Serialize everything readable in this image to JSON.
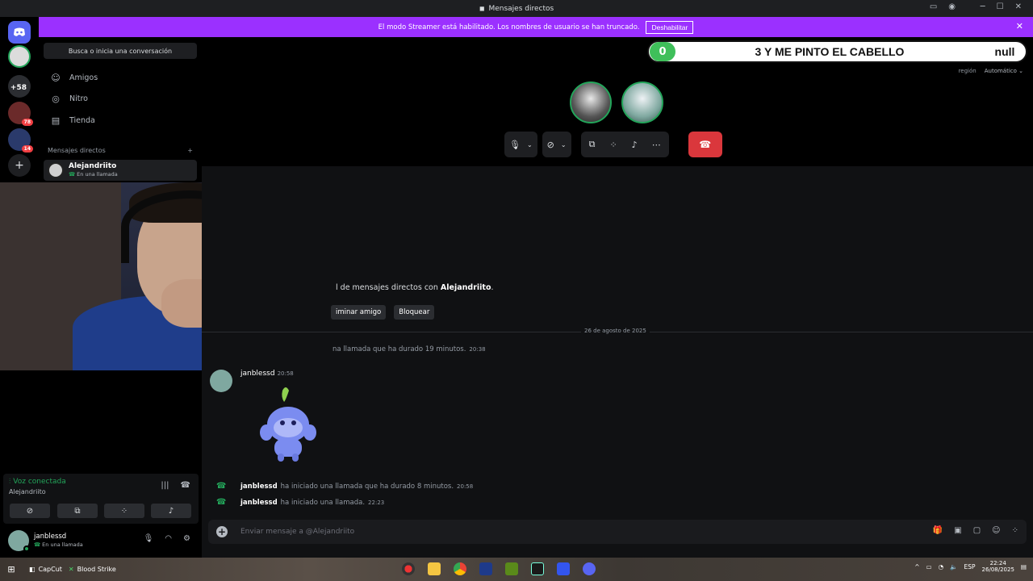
{
  "window": {
    "title": "Mensajes directos",
    "minimize": "─",
    "maximize": "☐",
    "close": "✕"
  },
  "streamer_banner": {
    "text": "El modo Streamer está habilitado. Los nombres de usuario se han truncado.",
    "button": "Deshabilitar",
    "close": "✕"
  },
  "servers": {
    "badges": [
      "+58",
      "78",
      "14"
    ]
  },
  "sidebar": {
    "search": "Busca o inicia una conversación",
    "nav": [
      {
        "label": "Amigos",
        "icon": "friends-icon"
      },
      {
        "label": "Nitro",
        "icon": "nitro-icon"
      },
      {
        "label": "Tienda",
        "icon": "shop-icon"
      }
    ],
    "dm_header": "Mensajes directos",
    "dm_add": "+",
    "dm": {
      "name": "Alejandriito",
      "status": "En una llamada"
    }
  },
  "voice": {
    "status": "Voz conectada",
    "channel": "Alejandriito"
  },
  "user": {
    "name": "janblessd",
    "status": "En una llamada"
  },
  "call": {
    "counter_value": "0",
    "counter_title": "3 Y ME PINTO EL CABELLO",
    "counter_right": "null",
    "region_label": "región",
    "region_value": "Automático ⌄"
  },
  "chat": {
    "intro_text": "l de mensajes directos con ",
    "intro_name": "Alejandriito",
    "intro_end": ".",
    "btn_remove": "iminar amigo",
    "btn_block": "Bloquear",
    "date": "26 de agosto de 2025",
    "call1": {
      "text": "na llamada que ha durado 19 minutos.",
      "time": "20:38"
    },
    "message": {
      "author": "janblessd",
      "time": "20:58"
    },
    "call2": {
      "author": "janblessd",
      "text": "ha iniciado una llamada que ha durado 8 minutos.",
      "time": "20:58"
    },
    "call3": {
      "author": "janblessd",
      "text": "ha iniciado una llamada.",
      "time": "22:23"
    },
    "composer_placeholder": "Enviar mensaje a @Alejandriito"
  },
  "taskbar": {
    "app1": "CapCut",
    "app2": "Blood Strike",
    "lang": "ESP",
    "time": "22:24",
    "date": "26/08/2025"
  },
  "colors": {
    "streamer": "#9b30ff",
    "green": "#23a55a",
    "hangup": "#da373c",
    "discord": "#5865f2"
  }
}
